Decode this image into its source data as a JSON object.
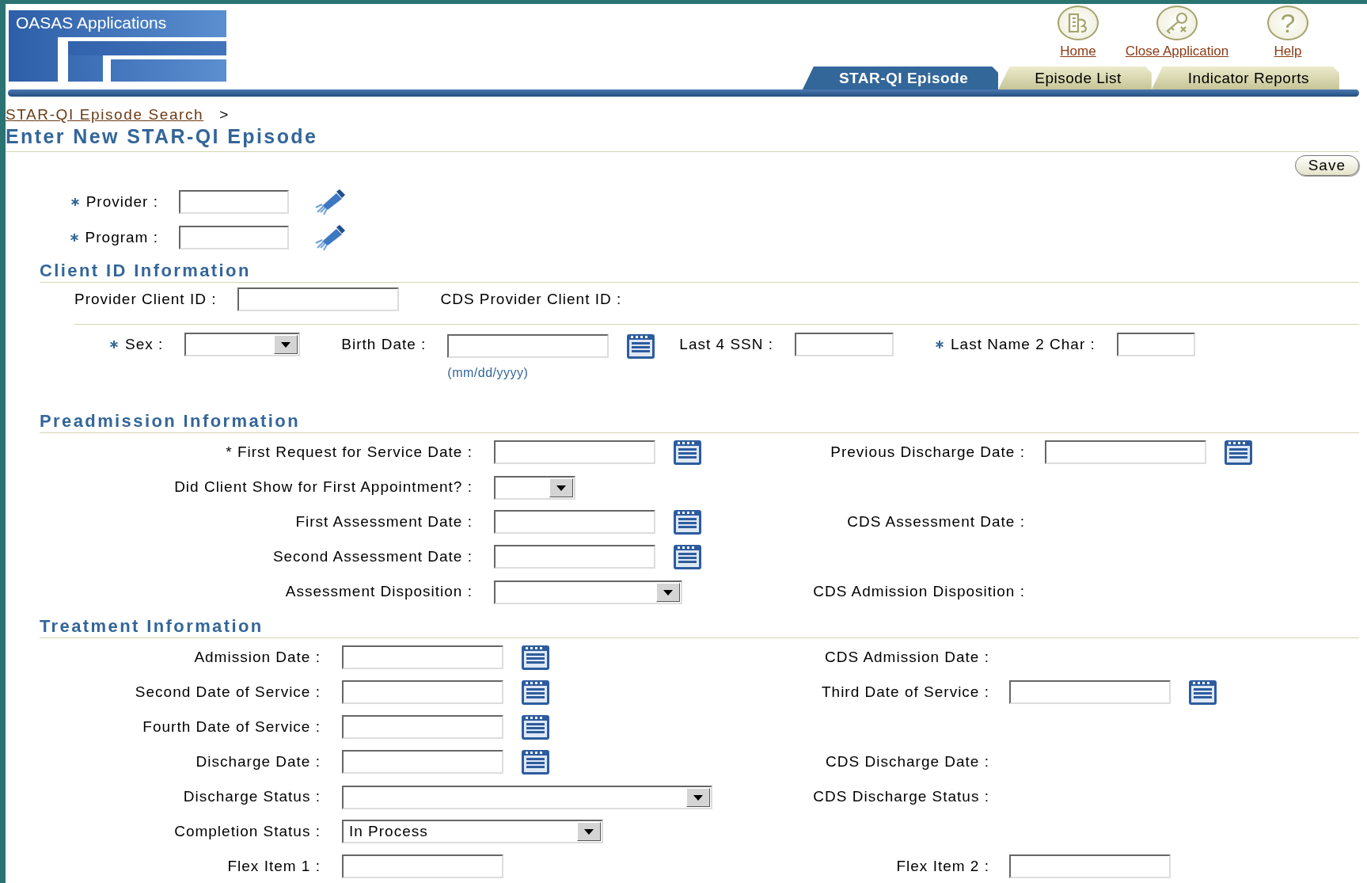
{
  "header": {
    "logo_text": "OASAS Applications",
    "links": [
      {
        "kind": "home",
        "label": "Home"
      },
      {
        "kind": "close",
        "label": "Close Application"
      },
      {
        "kind": "help",
        "label": "Help",
        "glyph": "?"
      }
    ],
    "tabs": [
      {
        "label": "STAR-QI Episode",
        "selected": true
      },
      {
        "label": "Episode List",
        "selected": false
      },
      {
        "label": "Indicator Reports",
        "selected": false
      }
    ]
  },
  "breadcrumb": {
    "link": "STAR-QI Episode Search",
    "separator": ">"
  },
  "page_title": "Enter New STAR-QI Episode",
  "save_button": "Save",
  "top_fields": [
    {
      "label": "Provider :",
      "required": true,
      "field": {
        "kind": "lookup"
      }
    },
    {
      "label": "Program :",
      "required": true,
      "field": {
        "kind": "lookup"
      }
    }
  ],
  "sections": [
    {
      "title": "Client ID Information",
      "kind": "inline",
      "rows": [
        {
          "cells": [
            {
              "label": "Provider Client ID :",
              "required": false,
              "field": {
                "kind": "text"
              }
            },
            {
              "label": "CDS Provider Client ID :",
              "required": false
            }
          ]
        },
        {
          "cells": [
            {
              "label": "Sex :",
              "required": true,
              "field": {
                "kind": "select"
              }
            },
            {
              "label": "Birth Date :",
              "required": false,
              "field": {
                "kind": "date",
                "hint": "(mm/dd/yyyy)"
              }
            },
            {
              "label": "Last 4 SSN :",
              "required": false,
              "field": {
                "kind": "text"
              }
            },
            {
              "label": "Last Name 2 Char :",
              "required": true,
              "field": {
                "kind": "text"
              }
            }
          ]
        }
      ]
    },
    {
      "title": "Preadmission Information",
      "kind": "columns",
      "rows": [
        {
          "left": {
            "label": "* First Request for Service Date :",
            "required": false,
            "field": {
              "kind": "date"
            }
          },
          "right": {
            "label": "Previous Discharge Date :",
            "required": false,
            "field": {
              "kind": "date"
            }
          }
        },
        {
          "left": {
            "label": "Did Client Show for First Appointment? :",
            "required": false,
            "field": {
              "kind": "select"
            }
          }
        },
        {
          "left": {
            "label": "First Assessment Date :",
            "required": false,
            "field": {
              "kind": "date"
            }
          },
          "right": {
            "label": "CDS Assessment Date :",
            "required": false
          }
        },
        {
          "left": {
            "label": "Second Assessment Date :",
            "required": false,
            "field": {
              "kind": "date"
            }
          }
        },
        {
          "left": {
            "label": "Assessment Disposition :",
            "required": false,
            "field": {
              "kind": "select"
            }
          },
          "right": {
            "label": "CDS Admission Disposition :",
            "required": false
          }
        }
      ]
    },
    {
      "title": "Treatment Information",
      "kind": "columns",
      "rows": [
        {
          "left": {
            "label": "Admission Date :",
            "required": false,
            "field": {
              "kind": "date"
            }
          },
          "right": {
            "label": "CDS Admission Date :",
            "required": false
          }
        },
        {
          "left": {
            "label": "Second Date of Service :",
            "required": false,
            "field": {
              "kind": "date"
            }
          },
          "right": {
            "label": "Third Date of Service :",
            "required": false,
            "field": {
              "kind": "date"
            }
          }
        },
        {
          "left": {
            "label": "Fourth Date of Service :",
            "required": false,
            "field": {
              "kind": "date"
            }
          }
        },
        {
          "left": {
            "label": "Discharge Date :",
            "required": false,
            "field": {
              "kind": "date"
            }
          },
          "right": {
            "label": "CDS Discharge Date :",
            "required": false
          }
        },
        {
          "left": {
            "label": "Discharge Status :",
            "required": false,
            "field": {
              "kind": "select"
            }
          },
          "right": {
            "label": "CDS Discharge Status :",
            "required": false
          }
        },
        {
          "left": {
            "label": "Completion Status :",
            "required": false,
            "field": {
              "kind": "select",
              "value": "In Process"
            }
          }
        },
        {
          "left": {
            "label": "Flex Item 1 :",
            "required": false,
            "field": {
              "kind": "text"
            }
          },
          "right": {
            "label": "Flex Item 2 :",
            "required": false,
            "field": {
              "kind": "text"
            }
          }
        }
      ]
    }
  ]
}
